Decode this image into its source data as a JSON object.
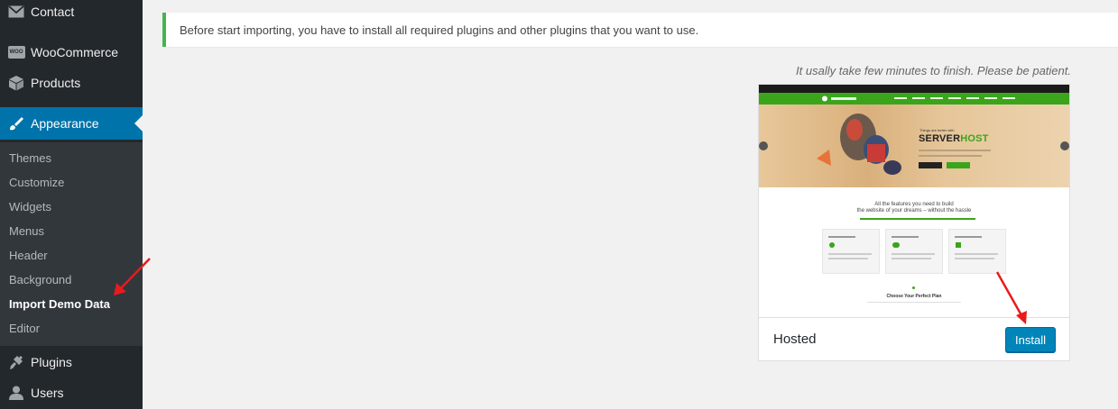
{
  "sidebar": {
    "items": [
      {
        "label": "Contact",
        "icon": "mail-icon"
      },
      {
        "label": "WooCommerce",
        "icon": "woocommerce-icon"
      },
      {
        "label": "Products",
        "icon": "box-icon"
      },
      {
        "label": "Appearance",
        "icon": "paintbrush-icon"
      },
      {
        "label": "Plugins",
        "icon": "plug-icon"
      },
      {
        "label": "Users",
        "icon": "user-icon"
      }
    ],
    "submenu": [
      "Themes",
      "Customize",
      "Widgets",
      "Menus",
      "Header",
      "Background",
      "Import Demo Data",
      "Editor"
    ],
    "woo_badge": "WOO"
  },
  "notice": {
    "text": "Before start importing, you have to install all required plugins and other plugins that you want to use."
  },
  "patience_text": "It usally take few minutes to finish. Please be patient.",
  "demo": {
    "name": "Hosted",
    "install_label": "Install",
    "preview": {
      "tagline": "Things are better with",
      "brand_a": "SERVER",
      "brand_b": "HOST",
      "headline_1": "All the features you need to build",
      "headline_2": "the website of your dreams – without the hassle",
      "plan_heading": "Choose Your Perfect Plan"
    }
  },
  "colors": {
    "sidebar_bg": "#23282d",
    "submenu_bg": "#32373c",
    "active_bg": "#0073aa",
    "notice_border": "#46b450",
    "button_bg": "#0085ba",
    "preview_green": "#3aa51b",
    "arrow_red": "#e81b1b"
  }
}
